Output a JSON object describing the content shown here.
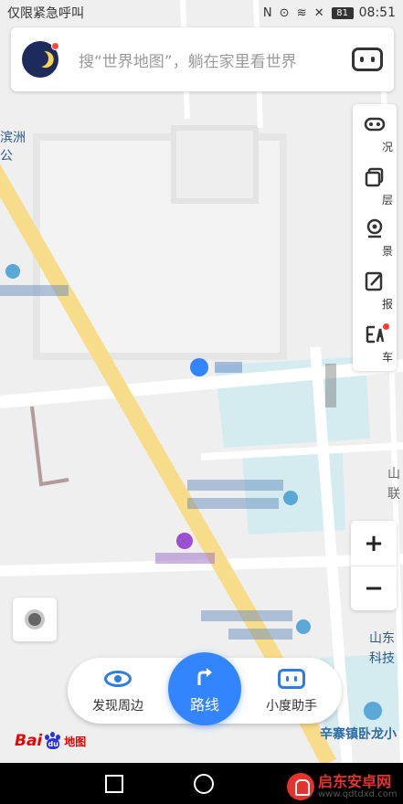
{
  "status_bar": {
    "left_text": "仅限紧急呼叫",
    "icons": "N ⊙ ≋ ✕",
    "battery": "81",
    "time": "08:51"
  },
  "search": {
    "placeholder": "搜“世界地图”，躺在家里看世界"
  },
  "tools": [
    {
      "label": "况",
      "icon": "traffic-icon"
    },
    {
      "label": "层",
      "icon": "layers-icon"
    },
    {
      "label": "景",
      "icon": "street-view-icon"
    },
    {
      "label": "报",
      "icon": "report-icon"
    },
    {
      "label": "车",
      "icon": "taxi-icon"
    }
  ],
  "map": {
    "labels": {
      "top_left_1": "滨洲",
      "top_left_2": "公",
      "street": "辛寨镇卧龙小",
      "shandong": "山东",
      "keji": "科技",
      "shan": "山",
      "lian": "联"
    }
  },
  "zoom": {
    "in": "+",
    "out": "−"
  },
  "actions": {
    "discover": "发现周边",
    "route": "路线",
    "assistant": "小度助手"
  },
  "logo": {
    "bai": "Bai",
    "du": "du",
    "map": "地图"
  },
  "watermark": {
    "title": "启东安卓网",
    "url": "www.qdtdxd.com"
  },
  "colors": {
    "accent": "#3385ff",
    "road_main": "#f7dc8a",
    "water": "#d4ecf0"
  }
}
